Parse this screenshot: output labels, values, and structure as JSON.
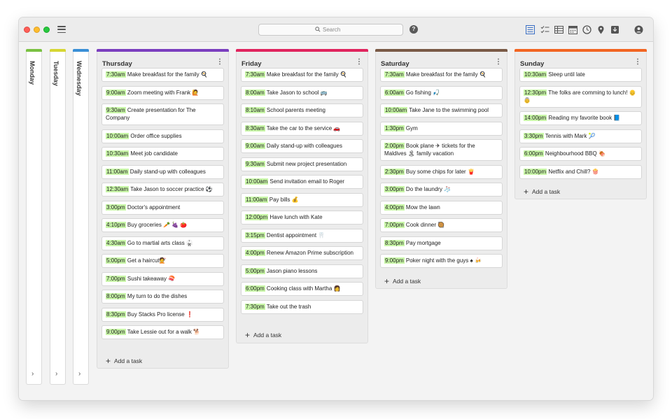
{
  "toolbar": {
    "search_placeholder": "Search",
    "help": "?",
    "icons": [
      "board-view-icon",
      "checklist-icon",
      "table-view-icon",
      "calendar-icon",
      "clock-icon",
      "location-icon",
      "archive-icon",
      "account-icon"
    ]
  },
  "collapsed_columns": [
    {
      "label": "Monday",
      "color": "#7ac142"
    },
    {
      "label": "Tuesday",
      "color": "#d6d633"
    },
    {
      "label": "Wednesday",
      "color": "#3a8fd6"
    }
  ],
  "columns": [
    {
      "title": "Thursday",
      "color": "#7b3fbf",
      "add_label": "Add a task",
      "tasks": [
        {
          "time": "7:30am",
          "text": " Make breakfast for the family 🍳"
        },
        {
          "time": "9:00am",
          "text": " Zoom meeting with Frank 🙋"
        },
        {
          "time": "9:30am",
          "text": " Create presentation for The Company"
        },
        {
          "time": "10:00am",
          "text": " Order office supplies"
        },
        {
          "time": "10:30am",
          "text": " Meet job candidate"
        },
        {
          "time": "11:00am",
          "text": " Daily stand-up with colleagues"
        },
        {
          "time": "12:30am",
          "text": " Take Jason to soccer practice ⚽"
        },
        {
          "time": "3:00pm",
          "text": " Doctor's appointment"
        },
        {
          "time": "4:10pm",
          "text": " Buy groceries 🥕 🍇 🍅"
        },
        {
          "time": "4:30am",
          "text": " Go to martial arts class 🥋"
        },
        {
          "time": "5:00pm",
          "text": " Get a haircut💇"
        },
        {
          "time": "7:00pm",
          "text": " Sushi takeaway 🍣"
        },
        {
          "time": "8:00pm",
          "text": " My turn to do the dishes"
        },
        {
          "time": "8:30pm",
          "text": " Buy Stacks Pro license ❗"
        },
        {
          "time": "9:00pm",
          "text": " Take Lessie out for a walk 🐕"
        }
      ]
    },
    {
      "title": "Friday",
      "color": "#e0245e",
      "add_label": "Add a task",
      "tasks": [
        {
          "time": "7:30am",
          "text": " Make breakfast for the family 🍳"
        },
        {
          "time": "8:00am",
          "text": " Take Jason to school 🚌"
        },
        {
          "time": "8:10am",
          "text": " School parents meeting"
        },
        {
          "time": "8:30am",
          "text": " Take the car to the service 🚗"
        },
        {
          "time": "9:00am",
          "text": " Daily stand-up with colleagues"
        },
        {
          "time": "9:30am",
          "text": " Submit new project presentation"
        },
        {
          "time": "10:00am",
          "text": " Send invitation email to Roger"
        },
        {
          "time": "11:00am",
          "text": " Pay bills 💰"
        },
        {
          "time": "12:00pm",
          "text": " Have lunch with Kate"
        },
        {
          "time": "3:15pm",
          "text": " Dentist appointment 🦷"
        },
        {
          "time": "4:00pm",
          "text": " Renew Amazon Prime subscription"
        },
        {
          "time": "5:00pm",
          "text": " Jason piano lessons"
        },
        {
          "time": "6:00pm",
          "text": " Cooking class with Martha 👩"
        },
        {
          "time": "7:30pm",
          "text": " Take out the trash"
        }
      ]
    },
    {
      "title": "Saturday",
      "color": "#7a5a46",
      "add_label": "Add a task",
      "tasks": [
        {
          "time": "7:30am",
          "text": " Make breakfast for the family 🍳"
        },
        {
          "time": "6:00am",
          "text": " Go fishing 🎣"
        },
        {
          "time": "10:00am",
          "text": " Take Jane to the swimming pool"
        },
        {
          "time": "1:30pm",
          "text": " Gym"
        },
        {
          "time": "2:00pm",
          "text": " Book plane ✈ tickets for the Maldives 🏝 family vacation"
        },
        {
          "time": "2:30pm",
          "text": " Buy some chips for later 🍟"
        },
        {
          "time": "3:00pm",
          "text": " Do the laundry 🧦"
        },
        {
          "time": "4:00pm",
          "text": " Mow the lawn"
        },
        {
          "time": "7:00pm",
          "text": " Cook dinner 🥘"
        },
        {
          "time": "8:30pm",
          "text": " Pay mortgage"
        },
        {
          "time": "9:00pm",
          "text": " Poker night with the guys ♠ 🍻"
        }
      ]
    },
    {
      "title": "Sunday",
      "color": "#f26522",
      "add_label": "Add a task",
      "tasks": [
        {
          "time": "10:30am",
          "text": " Sleep until late"
        },
        {
          "time": "12:30pm",
          "text": " The folks are comming to lunch! 👴 👵"
        },
        {
          "time": "14:00pm",
          "text": " Reading my favorite book 📘"
        },
        {
          "time": "3:30pm",
          "text": " Tennis with Mark 🎾"
        },
        {
          "time": "6:00pm",
          "text": " Neighbourhood BBQ 🍖"
        },
        {
          "time": "10:00pm",
          "text": " Netflix and Chill? 🍿"
        }
      ]
    }
  ]
}
